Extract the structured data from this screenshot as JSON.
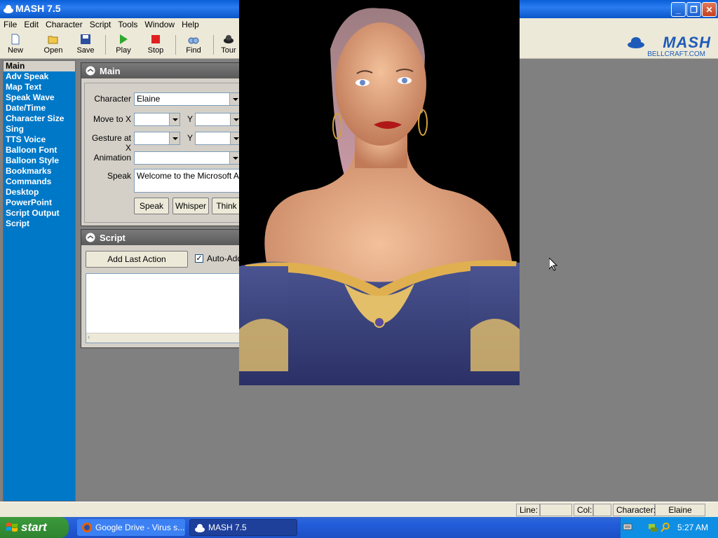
{
  "window": {
    "title": "MASH 7.5",
    "controls": {
      "minimize": "_",
      "restore": "❐",
      "close": "✕"
    }
  },
  "menu": [
    "File",
    "Edit",
    "Character",
    "Script",
    "Tools",
    "Window",
    "Help"
  ],
  "toolbar": {
    "new": "New",
    "open": "Open",
    "save": "Save",
    "play": "Play",
    "stop": "Stop",
    "find": "Find",
    "tour": "Tour"
  },
  "logo": {
    "name": "MASH",
    "sub": "BELLCRAFT.COM"
  },
  "sidebar": {
    "items": [
      "Main",
      "Adv Speak",
      "Map Text",
      "Speak Wave",
      "Date/Time",
      "Character Size",
      "Sing",
      "TTS Voice",
      "Balloon Font",
      "Balloon Style",
      "Bookmarks",
      "Commands",
      "Desktop",
      "PowerPoint",
      "Script Output",
      "Script"
    ],
    "selected": "Main"
  },
  "main_panel": {
    "title": "Main",
    "character_label": "Character",
    "character_value": "Elaine",
    "move_label": "Move to X",
    "move_y_label": "Y",
    "gesture_label": "Gesture at X",
    "gesture_y_label": "Y",
    "animation_label": "Animation",
    "speak_label": "Speak",
    "speak_text": "Welcome to the Microsoft Agen",
    "buttons": {
      "speak": "Speak",
      "whisper": "Whisper",
      "think": "Think"
    }
  },
  "script_panel": {
    "title": "Script",
    "add_last_action": "Add Last Action",
    "auto_add": "Auto-Add",
    "auto_add_checked": true
  },
  "statusbar": {
    "line_label": "Line:",
    "line_value": "",
    "col_label": "Col:",
    "col_value": "",
    "character_label": "Character:",
    "character_value": "Elaine"
  },
  "taskbar": {
    "start": "start",
    "tasks": [
      "Google Drive - Virus s...",
      "MASH 7.5"
    ],
    "clock": "5:27 AM"
  },
  "colors": {
    "sidebar": "#0078c8",
    "titlebar": "#0a5fd8",
    "taskbar": "#245edb",
    "start": "#3c9a3c"
  }
}
